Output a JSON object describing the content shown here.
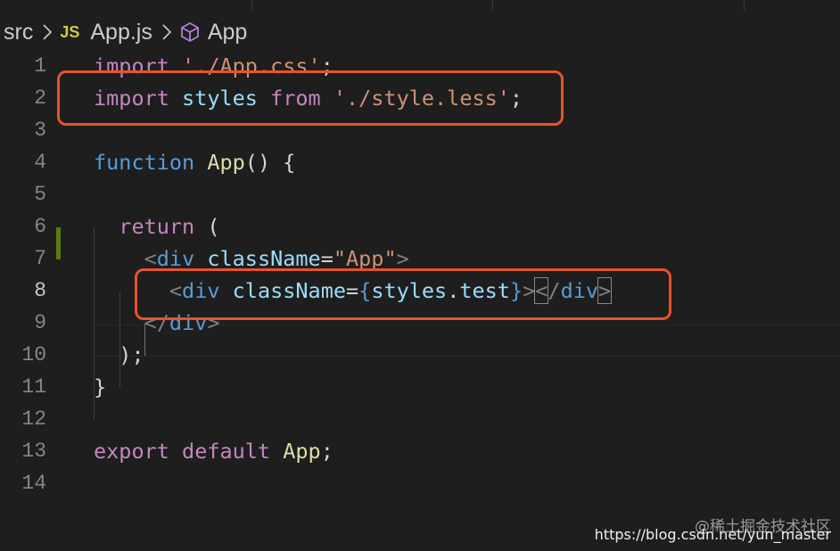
{
  "breadcrumb": {
    "folder": "src",
    "file_badge": "JS",
    "file": "App.js",
    "symbol": "App"
  },
  "lines": [
    {
      "n": "1",
      "tokens": [
        {
          "t": "import",
          "c": "kw"
        },
        {
          "t": " ",
          "c": "ws"
        },
        {
          "t": "'./App.css'",
          "c": "str"
        },
        {
          "t": ";",
          "c": "ws"
        }
      ]
    },
    {
      "n": "2",
      "tokens": [
        {
          "t": "import",
          "c": "kw"
        },
        {
          "t": " ",
          "c": "ws"
        },
        {
          "t": "styles",
          "c": "var"
        },
        {
          "t": " ",
          "c": "ws"
        },
        {
          "t": "from",
          "c": "kw"
        },
        {
          "t": " ",
          "c": "ws"
        },
        {
          "t": "'./style.less'",
          "c": "str"
        },
        {
          "t": ";",
          "c": "ws"
        }
      ]
    },
    {
      "n": "3",
      "tokens": []
    },
    {
      "n": "4",
      "tokens": [
        {
          "t": "function",
          "c": "kw-blue"
        },
        {
          "t": " ",
          "c": "ws"
        },
        {
          "t": "App",
          "c": "fn"
        },
        {
          "t": "() {",
          "c": "ws"
        }
      ]
    },
    {
      "n": "5",
      "tokens": []
    },
    {
      "n": "6",
      "tokens": [
        {
          "t": "  ",
          "c": "ws"
        },
        {
          "t": "return",
          "c": "kw"
        },
        {
          "t": " (",
          "c": "ws"
        }
      ]
    },
    {
      "n": "7",
      "tokens": [
        {
          "t": "    ",
          "c": "ws"
        },
        {
          "t": "<",
          "c": "punct"
        },
        {
          "t": "div",
          "c": "tag"
        },
        {
          "t": " ",
          "c": "ws"
        },
        {
          "t": "className",
          "c": "attr"
        },
        {
          "t": "=",
          "c": "ws"
        },
        {
          "t": "\"App\"",
          "c": "str"
        },
        {
          "t": ">",
          "c": "punct"
        }
      ]
    },
    {
      "n": "8",
      "tokens": [
        {
          "t": "      ",
          "c": "ws"
        },
        {
          "t": "<",
          "c": "punct"
        },
        {
          "t": "div",
          "c": "tag"
        },
        {
          "t": " ",
          "c": "ws"
        },
        {
          "t": "className",
          "c": "attr"
        },
        {
          "t": "=",
          "c": "ws"
        },
        {
          "t": "{",
          "c": "brace"
        },
        {
          "t": "styles",
          "c": "var"
        },
        {
          "t": ".",
          "c": "ws"
        },
        {
          "t": "test",
          "c": "var"
        },
        {
          "t": "}",
          "c": "brace"
        },
        {
          "t": ">",
          "c": "punct"
        },
        {
          "t": "<",
          "c": "punct",
          "match": true
        },
        {
          "t": "/",
          "c": "punct"
        },
        {
          "t": "div",
          "c": "tag"
        },
        {
          "t": ">",
          "c": "punct",
          "match": true
        }
      ]
    },
    {
      "n": "9",
      "tokens": [
        {
          "t": "    ",
          "c": "ws"
        },
        {
          "t": "</",
          "c": "punct"
        },
        {
          "t": "div",
          "c": "tag"
        },
        {
          "t": ">",
          "c": "punct"
        }
      ]
    },
    {
      "n": "10",
      "tokens": [
        {
          "t": "  ",
          "c": "ws"
        },
        {
          "t": ");",
          "c": "ws"
        }
      ]
    },
    {
      "n": "11",
      "tokens": [
        {
          "t": "}",
          "c": "ws"
        }
      ]
    },
    {
      "n": "12",
      "tokens": []
    },
    {
      "n": "13",
      "tokens": [
        {
          "t": "export",
          "c": "kw"
        },
        {
          "t": " ",
          "c": "ws"
        },
        {
          "t": "default",
          "c": "kw"
        },
        {
          "t": " ",
          "c": "ws"
        },
        {
          "t": "App",
          "c": "fn"
        },
        {
          "t": ";",
          "c": "ws"
        }
      ]
    },
    {
      "n": "14",
      "tokens": []
    }
  ],
  "active_line": "8",
  "watermark": {
    "site": "@稀土掘金技术社区",
    "url": "https://blog.csdn.net/yun_master"
  },
  "colors": {
    "background": "#1e1e1e",
    "highlight_box": "#e8532b",
    "modified_gutter": "#587c0c"
  }
}
